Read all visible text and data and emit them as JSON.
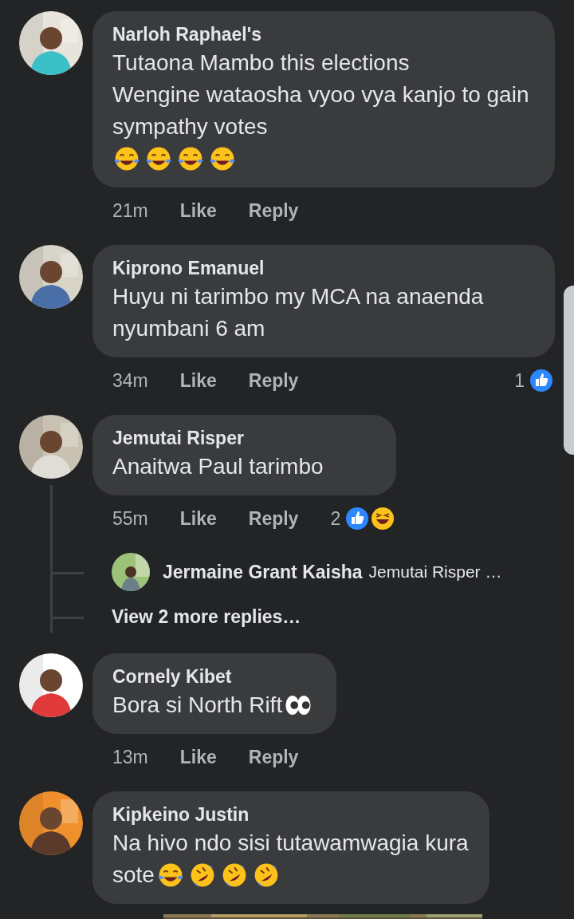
{
  "comments": [
    {
      "author": "Narloh Raphael's",
      "lines": [
        {
          "text": "Tutaona Mambo this elections"
        },
        {
          "text": "Wengine wataosha vyoo vya kanjo to gain sympathy votes"
        },
        {
          "emojis": [
            {
              "kind": "tears_of_joy"
            },
            {
              "kind": "tears_of_joy"
            },
            {
              "kind": "tears_of_joy"
            },
            {
              "kind": "tears_of_joy"
            }
          ]
        }
      ],
      "time": "21m",
      "actions": [
        "Like",
        "Reply"
      ]
    },
    {
      "author": "Kiprono Emanuel",
      "lines": [
        {
          "text": "Huyu ni tarimbo my MCA na anaenda nyumbani 6 am"
        }
      ],
      "time": "34m",
      "actions": [
        "Like",
        "Reply"
      ],
      "reactions": {
        "count": "1",
        "types": [
          {
            "kind": "like"
          }
        ]
      }
    },
    {
      "author": "Jemutai Risper",
      "lines": [
        {
          "text": "Anaitwa Paul tarimbo"
        }
      ],
      "time": "55m",
      "actions": [
        "Like",
        "Reply"
      ],
      "reactions": {
        "count": "2",
        "types": [
          {
            "kind": "like"
          },
          {
            "kind": "haha"
          }
        ]
      },
      "replies": [
        {
          "author": "Jermaine Grant Kaisha",
          "text": "Jemutai Risper …"
        }
      ],
      "more_replies": "View 2 more replies…"
    },
    {
      "author": "Cornely Kibet",
      "lines": [
        {
          "text": "Bora si North Rift",
          "emojis": [
            {
              "kind": "eyes"
            }
          ]
        }
      ],
      "time": "13m",
      "actions": [
        "Like",
        "Reply"
      ]
    },
    {
      "author": "Kipkeino Justin",
      "lines": [
        {
          "text": "Na hivo ndo sisi tutawamwagia kura"
        },
        {
          "text": "sote",
          "emojis": [
            {
              "kind": "tears_of_joy"
            },
            {
              "kind": "rofl"
            },
            {
              "kind": "rofl"
            },
            {
              "kind": "rofl"
            }
          ]
        }
      ]
    }
  ]
}
